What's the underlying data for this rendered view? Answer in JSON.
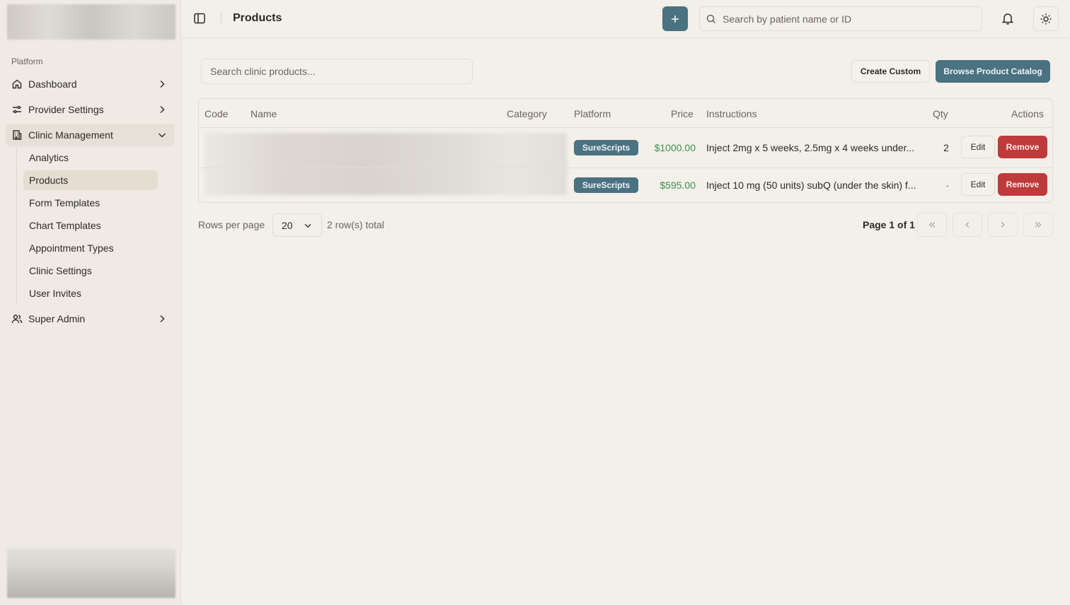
{
  "sidebar": {
    "section_label": "Platform",
    "items": [
      {
        "label": "Dashboard"
      },
      {
        "label": "Provider Settings"
      },
      {
        "label": "Clinic Management"
      },
      {
        "label": "Super Admin"
      }
    ],
    "sub_items": [
      {
        "label": "Analytics"
      },
      {
        "label": "Products"
      },
      {
        "label": "Form Templates"
      },
      {
        "label": "Chart Templates"
      },
      {
        "label": "Appointment Types"
      },
      {
        "label": "Clinic Settings"
      },
      {
        "label": "User Invites"
      }
    ]
  },
  "header": {
    "title": "Products",
    "search_placeholder": "Search by patient name or ID"
  },
  "toolbar": {
    "search_placeholder": "Search clinic products...",
    "create_label": "Create Custom",
    "browse_label": "Browse Product Catalog"
  },
  "table": {
    "columns": [
      "Code",
      "Name",
      "Category",
      "Platform",
      "Price",
      "Instructions",
      "Qty",
      "Actions"
    ],
    "rows": [
      {
        "platform": "SureScripts",
        "price": "$1000.00",
        "instructions": "Inject 2mg x 5 weeks, 2.5mg x 4 weeks under...",
        "qty": "2",
        "edit": "Edit",
        "remove": "Remove"
      },
      {
        "platform": "SureScripts",
        "price": "$595.00",
        "instructions": "Inject 10 mg (50 units) subQ (under the skin) f...",
        "qty": "-",
        "edit": "Edit",
        "remove": "Remove"
      }
    ]
  },
  "pagination": {
    "rows_label": "Rows per page",
    "rows_value": "20",
    "total": "2 row(s) total",
    "page_info": "Page 1 of 1"
  },
  "colors": {
    "accent": "#4a7281",
    "danger": "#bf3a3a",
    "price": "#3f8f4f",
    "background": "#f3efe9"
  }
}
